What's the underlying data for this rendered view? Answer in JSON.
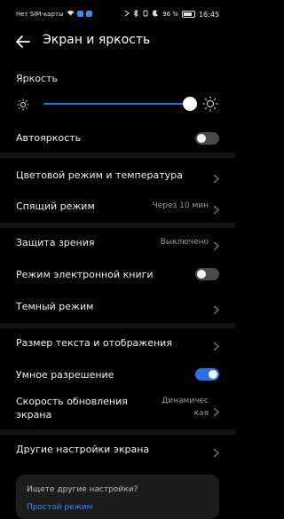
{
  "status_bar": {
    "carrier": "Нет SIM-карты",
    "battery": "96 %",
    "time": "16:45"
  },
  "header": {
    "title": "Экран и яркость"
  },
  "brightness": {
    "label": "Яркость",
    "level_fraction": 0.95
  },
  "settings": {
    "auto_brightness": {
      "label": "Автояркость",
      "enabled": false
    },
    "color_mode": {
      "label": "Цветовой режим и температура"
    },
    "sleep": {
      "label": "Спящий режим",
      "value": "Через 10 мин"
    },
    "eye_comfort": {
      "label": "Защита зрения",
      "value": "Выключено"
    },
    "ebook_mode": {
      "label": "Режим электронной книги",
      "enabled": false
    },
    "dark_mode": {
      "label": "Темный режим"
    },
    "text_size": {
      "label": "Размер текста и отображения"
    },
    "smart_resolution": {
      "label": "Умное разрешение",
      "enabled": true
    },
    "refresh_rate": {
      "label_line1": "Скорость обновления",
      "label_line2": "экрана",
      "value_line1": "Динамичес",
      "value_line2": "кая"
    },
    "other": {
      "label": "Другие настройки экрана"
    }
  },
  "suggestion": {
    "title": "Ищете другие настройки?",
    "link": "Простой режим"
  },
  "colors": {
    "accent": "#2f6fe0",
    "background": "#000000",
    "secondary_text": "#9a9a9a"
  }
}
